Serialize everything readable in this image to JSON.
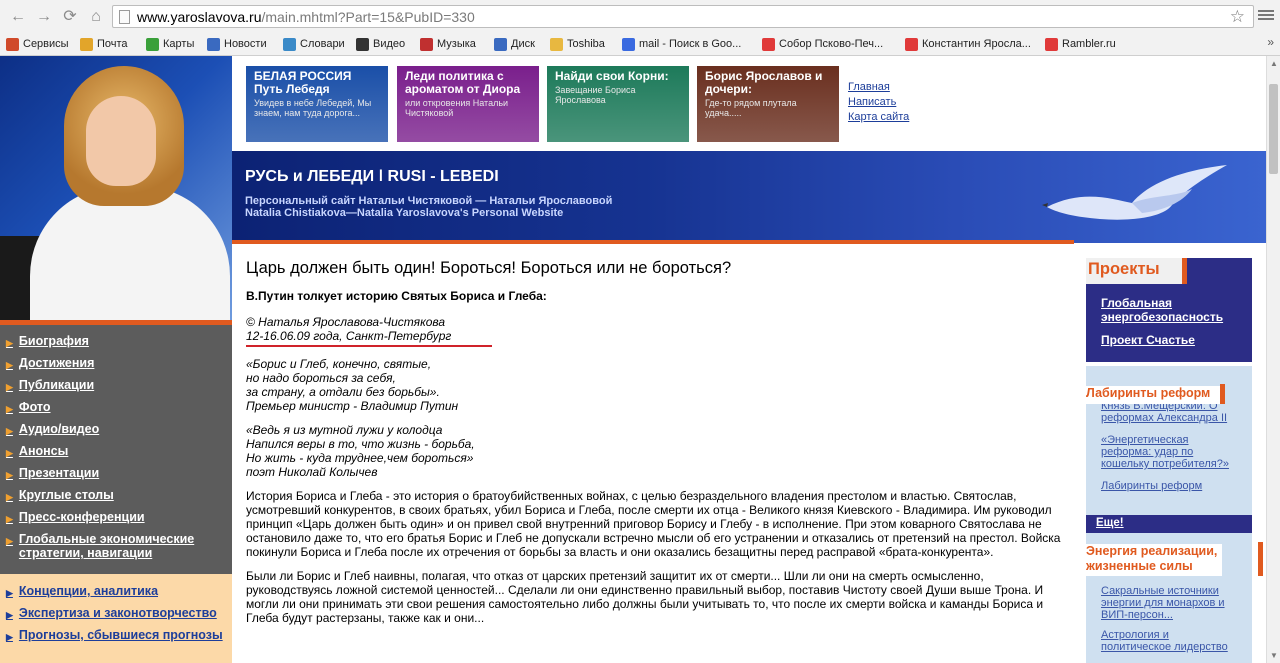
{
  "browser": {
    "url_host": "www.yaroslavova.ru",
    "url_path": "/main.mhtml?Part=15&PubID=330",
    "bookmarks": [
      {
        "label": "Сервисы",
        "icon": "apps-grid-icon",
        "color": "#d04a2a"
      },
      {
        "label": "Почта",
        "icon": "mail-icon",
        "color": "#e2a52a"
      },
      {
        "label": "Карты",
        "icon": "maps-icon",
        "color": "#3aa03a"
      },
      {
        "label": "Новости",
        "icon": "news-icon",
        "color": "#3a6ac0"
      },
      {
        "label": "Словари",
        "icon": "dictionary-icon",
        "color": "#3a8ac8"
      },
      {
        "label": "Видео",
        "icon": "video-icon",
        "color": "#333333"
      },
      {
        "label": "Музыка",
        "icon": "music-icon",
        "color": "#c03030"
      },
      {
        "label": "Диск",
        "icon": "disk-icon",
        "color": "#3a6ac0"
      },
      {
        "label": "Toshiba",
        "icon": "folder-icon",
        "color": "#e8b840"
      },
      {
        "label": "mail - Поиск в Goo...",
        "icon": "google-icon",
        "color": "#3a6ae0"
      },
      {
        "label": "Собор Псково-Печ...",
        "icon": "yandex-icon",
        "color": "#e03a3a"
      },
      {
        "label": "Константин Яросла...",
        "icon": "yandex-icon",
        "color": "#e03a3a"
      },
      {
        "label": "Rambler.ru",
        "icon": "yandex-icon",
        "color": "#e03a3a"
      }
    ],
    "more": "»"
  },
  "banners": [
    {
      "title": "БЕЛАЯ РОССИЯ\nПуть Лебедя",
      "sub": "Увидев в небе Лебедей, Мы знаем, нам туда дорога...",
      "color": "#1a4fa8",
      "title_color": "#ffffff"
    },
    {
      "title": "Леди политика с ароматом от Диора",
      "sub": "или откровения Натальи Чистяковой",
      "color": "#7a1f8c",
      "title_color": "#ffffff"
    },
    {
      "title": "Найди свои Корни:",
      "sub": "Завещание Бориса Ярославова",
      "color": "#1d7a5a",
      "title_color": "#ffffff"
    },
    {
      "title": "Борис Ярославов и дочери:",
      "sub": "Где-то рядом плутала удача.....",
      "color": "#6a2f1f",
      "title_color": "#ffffff"
    }
  ],
  "top_links": [
    "Главная",
    "Написать",
    "Карта сайта"
  ],
  "header": {
    "title": "РУСЬ и ЛЕБЕДИ ǀ RUSI - LEBEDI",
    "sub1": "Персональный сайт Натальи Чистяковой — Натальи Ярославовой",
    "sub2": "Natalia Chistiakova—Natalia Yaroslavova's  Personal Website"
  },
  "left_menu": [
    "Биография",
    "Достижения",
    "Публикации",
    "Фото",
    "Аудио/видео",
    "Анонсы",
    "Презентации",
    "Круглые столы",
    "Пресс-конференции",
    "Глобальные экономические стратегии, навигации"
  ],
  "left_lower_menu": [
    "Концепции, аналитика",
    "Экспертиза и законотворчество",
    "Прогнозы, сбывшиеся прогнозы"
  ],
  "article": {
    "title": "Царь должен быть один! Бороться! Бороться или не бороться?",
    "lead": "В.Путин толкует историю Святых Бориса и Глеба:",
    "author_line1": "© Наталья Ярославова-Чистякова",
    "author_line2": "12-16.06.09 года, Санкт-Петербург",
    "quote1": [
      "«Борис и Глеб, конечно, святые,",
      "но надо бороться за себя,",
      "за страну, а отдали без борьбы».",
      "Премьер министр - Владимир Путин"
    ],
    "quote2": [
      "«Ведь я из мутной лужи у колодца",
      "Напился веры в то, что жизнь - борьба,",
      "Но жить - куда труднее,чем бороться»",
      "поэт Николай Колычев"
    ],
    "para1": "История Бориса и Глеба - это история о братоубийственных войнах, с целью безраздельного владения престолом и властью. Святослав, усмотревший конкурентов, в своих братьях, убил Бориса и Глеба, после смерти их отца - Великого князя Киевского - Владимира. Им руководил принцип «Царь должен быть один» и он привел свой внутренний приговор Борису и Глебу - в исполнение. При этом коварного Святослава не остановило даже то, что его братья Борис и Глеб не допускали встречно мысли об его устранении и отказались от претензий на престол. Войска покинули Бориса и Глеба после их отречения от борьбы за власть и они оказались безащитны перед расправой «брата-конкурента».",
    "para2": "Были ли Борис и Глеб наивны, полагая, что отказ от царских претензий защитит их от смерти... Шли ли они на смерть осмысленно, руководствуясь ложной системой ценностей... Сделали ли они единственно правильный выбор, поставив Чистоту своей Души выше Трона. И могли ли они принимать эти свои решения самостоятельно либо должны были учитывать то, что после их смерти войска и каманды Бориса и Глеба будут растерзаны, также как и они..."
  },
  "right": {
    "projects_title": "Проекты",
    "projects": [
      "Глобальная энергобезопасность",
      "Проект Счастье"
    ],
    "labyrinth_title": "Лабиринты реформ",
    "labyrinth_links": [
      "Князь В.Мещерский: О реформах Александра II",
      "«Энергетическая реформа: удар по кошельку потребителя?»",
      "Лабиринты реформ"
    ],
    "more": "Еще!",
    "energy_title": "Энергия реализации, жизненные силы",
    "energy_links": [
      "Сакральные источники энергии для монархов и ВИП-персон...",
      "Астрология и политическое лидерство"
    ]
  },
  "colors": {
    "accent": "#e05a1f",
    "nav_blue": "#2c2d86",
    "link": "#1d3e9a"
  }
}
